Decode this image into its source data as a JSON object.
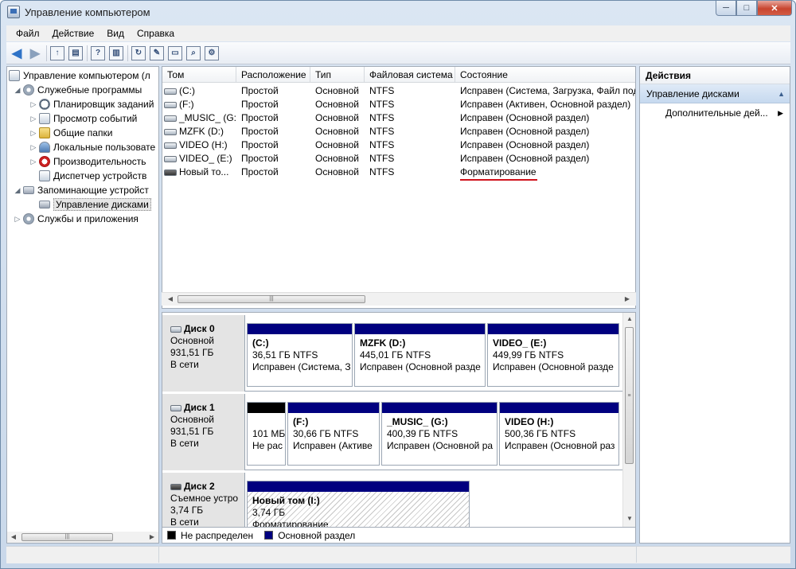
{
  "window": {
    "title": "Управление компьютером"
  },
  "menu": [
    "Файл",
    "Действие",
    "Вид",
    "Справка"
  ],
  "tree": {
    "items": [
      {
        "label": "Управление компьютером (л",
        "level": 0,
        "expander": "",
        "icon": "computer-icon"
      },
      {
        "label": "Служебные программы",
        "level": 1,
        "expander": "◢",
        "icon": "tools-icon"
      },
      {
        "label": "Планировщик заданий",
        "level": 2,
        "expander": "▷",
        "icon": "clock-icon"
      },
      {
        "label": "Просмотр событий",
        "level": 2,
        "expander": "▷",
        "icon": "event-viewer-icon"
      },
      {
        "label": "Общие папки",
        "level": 2,
        "expander": "▷",
        "icon": "folder-icon"
      },
      {
        "label": "Локальные пользовате",
        "level": 2,
        "expander": "▷",
        "icon": "users-icon"
      },
      {
        "label": "Производительность",
        "level": 2,
        "expander": "▷",
        "icon": "performance-icon"
      },
      {
        "label": "Диспетчер устройств",
        "level": 2,
        "expander": "",
        "icon": "device-manager-icon"
      },
      {
        "label": "Запоминающие устройст",
        "level": 1,
        "expander": "◢",
        "icon": "storage-icon"
      },
      {
        "label": "Управление дисками",
        "level": 2,
        "expander": "",
        "icon": "disk-management-icon",
        "selected": true
      },
      {
        "label": "Службы и приложения",
        "level": 1,
        "expander": "▷",
        "icon": "services-icon"
      }
    ]
  },
  "volumes": {
    "columns": [
      "Том",
      "Расположение",
      "Тип",
      "Файловая система",
      "Состояние"
    ],
    "rows": [
      {
        "name": "(C:)",
        "layout": "Простой",
        "type": "Основной",
        "fs": "NTFS",
        "status": "Исправен (Система, Загрузка, Файл под"
      },
      {
        "name": "(F:)",
        "layout": "Простой",
        "type": "Основной",
        "fs": "NTFS",
        "status": "Исправен (Активен, Основной раздел)"
      },
      {
        "name": "_MUSIC_ (G:)",
        "layout": "Простой",
        "type": "Основной",
        "fs": "NTFS",
        "status": "Исправен (Основной раздел)"
      },
      {
        "name": "MZFK (D:)",
        "layout": "Простой",
        "type": "Основной",
        "fs": "NTFS",
        "status": "Исправен (Основной раздел)"
      },
      {
        "name": "VIDEO (H:)",
        "layout": "Простой",
        "type": "Основной",
        "fs": "NTFS",
        "status": "Исправен (Основной раздел)"
      },
      {
        "name": "VIDEO_ (E:)",
        "layout": "Простой",
        "type": "Основной",
        "fs": "NTFS",
        "status": "Исправен (Основной раздел)"
      },
      {
        "name": "Новый то...",
        "layout": "Простой",
        "type": "Основной",
        "fs": "NTFS",
        "status": "Форматирование"
      }
    ]
  },
  "disks": [
    {
      "name": "Диск 0",
      "kind": "Основной",
      "size": "931,51 ГБ",
      "state": "В сети",
      "partitions": [
        {
          "label": "(C:)",
          "size": "36,51 ГБ NTFS",
          "status": "Исправен (Система, З"
        },
        {
          "label": "MZFK  (D:)",
          "size": "445,01 ГБ NTFS",
          "status": "Исправен (Основной разде"
        },
        {
          "label": "VIDEO_  (E:)",
          "size": "449,99 ГБ NTFS",
          "status": "Исправен (Основной разде"
        }
      ]
    },
    {
      "name": "Диск 1",
      "kind": "Основной",
      "size": "931,51 ГБ",
      "state": "В сети",
      "partitions": [
        {
          "label": "",
          "size": "101 МБ",
          "status": "Не рас"
        },
        {
          "label": "(F:)",
          "size": "30,66 ГБ NTFS",
          "status": "Исправен (Активе"
        },
        {
          "label": "_MUSIC_  (G:)",
          "size": "400,39 ГБ NTFS",
          "status": "Исправен (Основной ра"
        },
        {
          "label": "VIDEO  (H:)",
          "size": "500,36 ГБ NTFS",
          "status": "Исправен (Основной раз"
        }
      ]
    },
    {
      "name": "Диск 2",
      "kind": "Съемное устро",
      "size": "3,74 ГБ",
      "state": "В сети",
      "partitions": [
        {
          "label": "Новый том  (I:)",
          "size": "3,74 ГБ",
          "status": "Форматирование"
        }
      ]
    }
  ],
  "legend": {
    "unallocated": "Не распределен",
    "primary": "Основной раздел",
    "unallocated_color": "#000000",
    "primary_color": "#00007f"
  },
  "actions": {
    "header": "Действия",
    "group": "Управление дисками",
    "more": "Дополнительные дей..."
  },
  "colors": {
    "accent": "#00007f",
    "highlight": "#d0121b"
  }
}
